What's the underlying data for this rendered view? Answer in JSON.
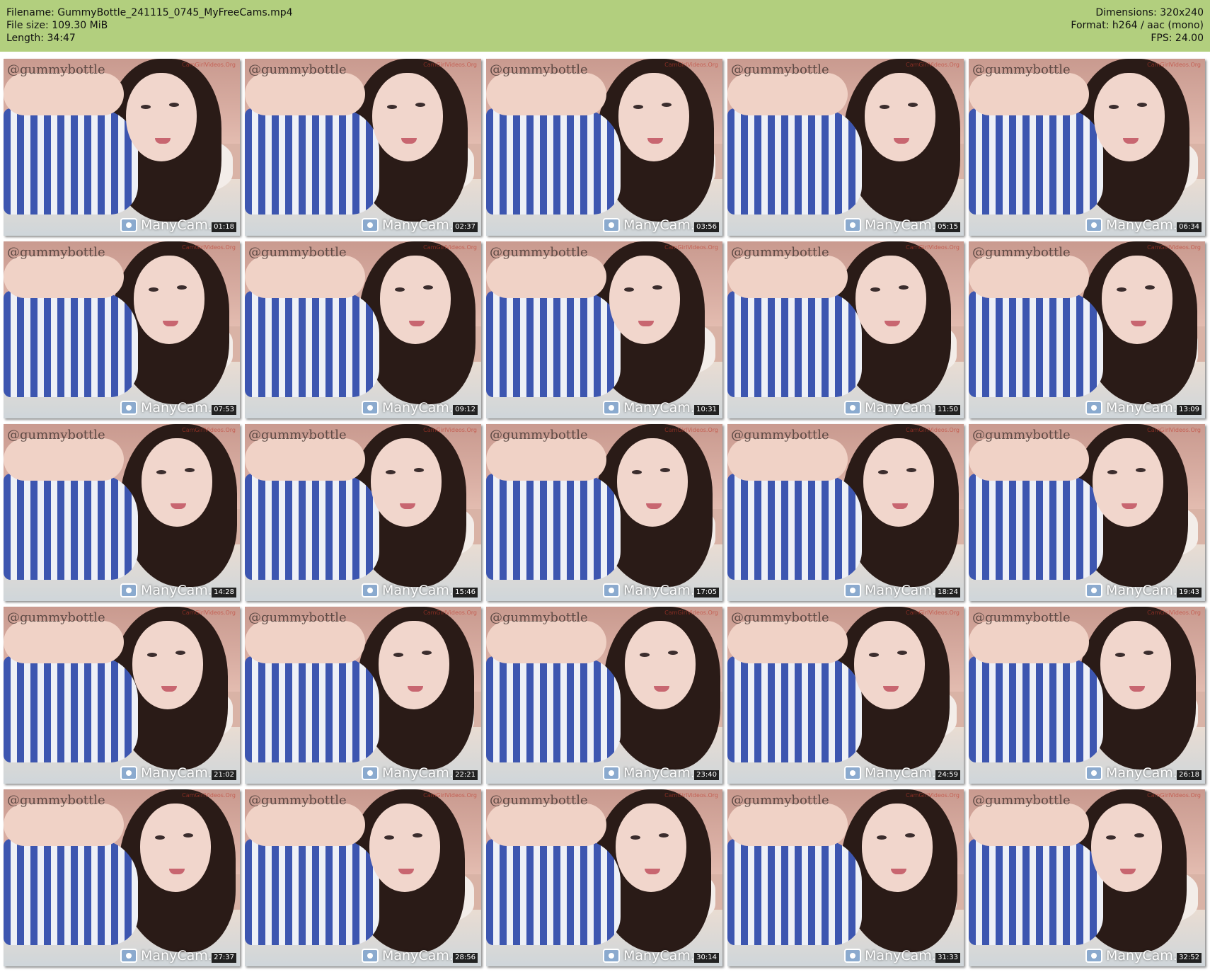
{
  "header": {
    "filename": "Filename: GummyBottle_241115_0745_MyFreeCams.mp4",
    "filesize": "File size: 109.30 MiB",
    "length": "Length: 34:47",
    "dimensions": "Dimensions: 320x240",
    "format": "Format: h264 / aac (mono)",
    "fps": "FPS: 24.00"
  },
  "thumb_watermark": "@gummybottle",
  "thumb_site": "CamGirlVideos.Org",
  "brand": "ManyCam.",
  "thumbnails": [
    {
      "time": "01:18"
    },
    {
      "time": "02:37"
    },
    {
      "time": "03:56"
    },
    {
      "time": "05:15"
    },
    {
      "time": "06:34"
    },
    {
      "time": "07:53"
    },
    {
      "time": "09:12"
    },
    {
      "time": "10:31"
    },
    {
      "time": "11:50"
    },
    {
      "time": "13:09"
    },
    {
      "time": "14:28"
    },
    {
      "time": "15:46"
    },
    {
      "time": "17:05"
    },
    {
      "time": "18:24"
    },
    {
      "time": "19:43"
    },
    {
      "time": "21:02"
    },
    {
      "time": "22:21"
    },
    {
      "time": "23:40"
    },
    {
      "time": "24:59"
    },
    {
      "time": "26:18"
    },
    {
      "time": "27:37"
    },
    {
      "time": "28:56"
    },
    {
      "time": "30:14"
    },
    {
      "time": "31:33"
    },
    {
      "time": "32:52"
    }
  ],
  "colors": {
    "header_bg": "#b2cf7e",
    "stripe_blue": "#3d56b0"
  }
}
